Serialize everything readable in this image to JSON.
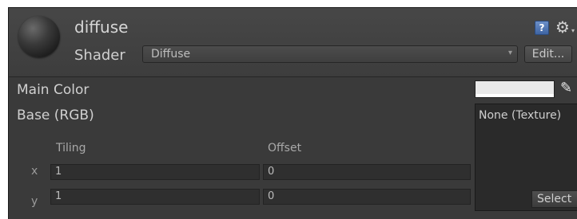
{
  "material": {
    "name": "diffuse",
    "shader_label": "Shader",
    "shader_value": "Diffuse",
    "edit_label": "Edit...",
    "help_icon_glyph": "?",
    "gear_icon_glyph": "⚙",
    "gear_arrow_glyph": "▾"
  },
  "properties": {
    "main_color_label": "Main Color",
    "main_color_value": "#e9e9e9",
    "base_label": "Base (RGB)"
  },
  "texture": {
    "label": "None (Texture)",
    "select_label": "Select"
  },
  "tiling_offset": {
    "tiling_header": "Tiling",
    "offset_header": "Offset",
    "rows": [
      {
        "axis": "x",
        "tiling": "1",
        "offset": "0"
      },
      {
        "axis": "y",
        "tiling": "1",
        "offset": "0"
      }
    ]
  }
}
